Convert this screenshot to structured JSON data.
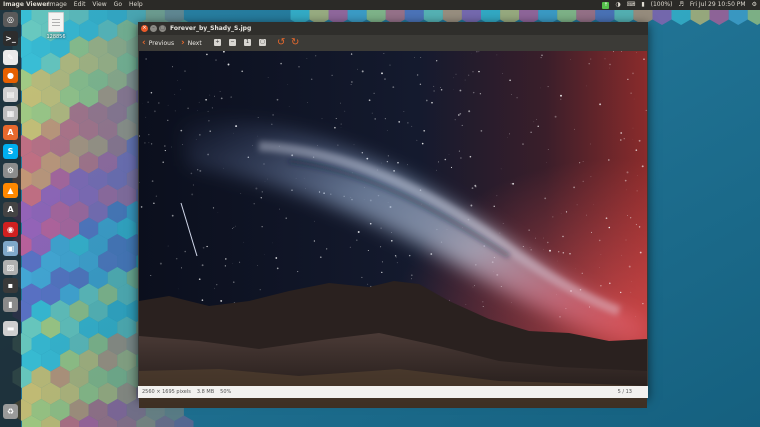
{
  "top_panel": {
    "app_name": "Image Viewer",
    "menus": [
      "Image",
      "Edit",
      "View",
      "Go",
      "Help"
    ],
    "battery": "(100%)",
    "clock": "Fri Jul 29 10:50 PM"
  },
  "desktop": {
    "file_label": "128856"
  },
  "launcher": {
    "items": [
      {
        "icon": "dash-home-icon",
        "glyph": "◎",
        "color": "#5a5a5a"
      },
      {
        "icon": "terminal-icon",
        "glyph": ">_",
        "color": "#2d2d2d"
      },
      {
        "icon": "text-editor-icon",
        "glyph": "✎",
        "color": "#eaeaea"
      },
      {
        "icon": "firefox-icon",
        "glyph": "●",
        "color": "#e66000"
      },
      {
        "icon": "files-icon",
        "glyph": "▤",
        "color": "#cfcfcf"
      },
      {
        "icon": "file-manager-icon",
        "glyph": "▦",
        "color": "#bdbdbd"
      },
      {
        "icon": "software-center-icon",
        "glyph": "A",
        "color": "#e8692d"
      },
      {
        "icon": "skype-icon",
        "glyph": "S",
        "color": "#00aff0"
      },
      {
        "icon": "settings-icon",
        "glyph": "⚙",
        "color": "#8c8c8c"
      },
      {
        "icon": "vlc-icon",
        "glyph": "▲",
        "color": "#ff8800"
      },
      {
        "icon": "updater-icon",
        "glyph": "A",
        "color": "#444444"
      },
      {
        "icon": "app-icon",
        "glyph": "◉",
        "color": "#d02020"
      },
      {
        "icon": "image-viewer-icon",
        "glyph": "▣",
        "color": "#7fa8c9"
      },
      {
        "icon": "photos-icon",
        "glyph": "▨",
        "color": "#b0b0b0"
      },
      {
        "icon": "workspace-icon",
        "glyph": "▪",
        "color": "#3a3a3a"
      },
      {
        "icon": "usb-drive-icon",
        "glyph": "▮",
        "color": "#8a8a8a"
      },
      {
        "icon": "drive-icon",
        "glyph": "▬",
        "color": "#cfcfcf"
      },
      {
        "icon": "trash-icon",
        "glyph": "♻",
        "color": "#9a9a9a"
      }
    ]
  },
  "window": {
    "title": "Forever_by_Shady_S.jpg",
    "toolbar": {
      "previous_label": "Previous",
      "next_label": "Next"
    },
    "status": {
      "dimensions": "2560 × 1695 pixels",
      "size": "3.8 MB",
      "zoom": "50%",
      "position": "5 / 13"
    }
  },
  "colors": {
    "accent": "#e8692d",
    "panel": "#2b2a27",
    "window_toolbar": "#3c3b37"
  }
}
